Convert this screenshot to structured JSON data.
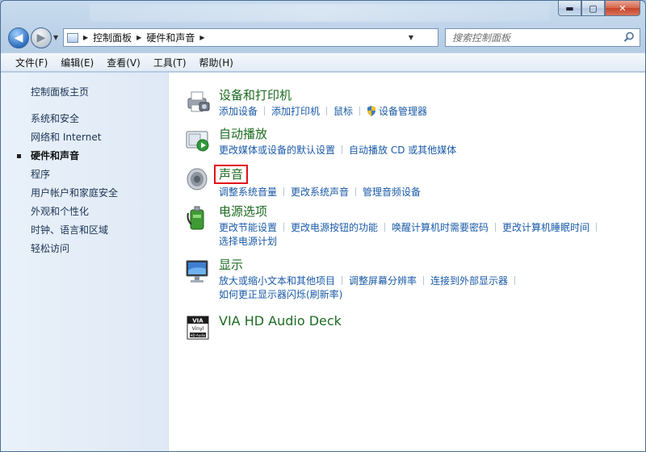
{
  "window": {
    "controls": {
      "minimize": "▬",
      "maximize": "▢",
      "close": "✕"
    }
  },
  "address": {
    "crumbs": [
      "控制面板",
      "硬件和声音"
    ],
    "search_placeholder": "搜索控制面板"
  },
  "menu": [
    "文件(F)",
    "编辑(E)",
    "查看(V)",
    "工具(T)",
    "帮助(H)"
  ],
  "sidebar": {
    "home": "控制面板主页",
    "items": [
      {
        "label": "系统和安全",
        "active": false
      },
      {
        "label": "网络和 Internet",
        "active": false
      },
      {
        "label": "硬件和声音",
        "active": true
      },
      {
        "label": "程序",
        "active": false
      },
      {
        "label": "用户帐户和家庭安全",
        "active": false
      },
      {
        "label": "外观和个性化",
        "active": false
      },
      {
        "label": "时钟、语言和区域",
        "active": false
      },
      {
        "label": "轻松访问",
        "active": false
      }
    ]
  },
  "categories": [
    {
      "title": "设备和打印机",
      "icon": "printer-icon",
      "links": [
        "添加设备",
        "添加打印机",
        "鼠标",
        "设备管理器"
      ]
    },
    {
      "title": "自动播放",
      "icon": "autoplay-icon",
      "links": [
        "更改媒体或设备的默认设置",
        "自动播放 CD 或其他媒体"
      ]
    },
    {
      "title": "声音",
      "icon": "speaker-icon",
      "highlighted": true,
      "links": [
        "调整系统音量",
        "更改系统声音",
        "管理音频设备"
      ]
    },
    {
      "title": "电源选项",
      "icon": "power-options-icon",
      "links": [
        "更改节能设置",
        "更改电源按钮的功能",
        "唤醒计算机时需要密码",
        "更改计算机睡眠时间",
        "选择电源计划"
      ]
    },
    {
      "title": "显示",
      "icon": "display-icon",
      "links": [
        "放大或缩小文本和其他项目",
        "调整屏幕分辨率",
        "连接到外部显示器",
        "如何更正显示器闪烁(刷新率)"
      ]
    },
    {
      "title": "VIA HD Audio Deck",
      "icon": "via-audio-icon",
      "links": []
    }
  ],
  "colors": {
    "category_title": "#1e6b22",
    "link": "#1a5aa8",
    "highlight_box": "#e2121b"
  }
}
